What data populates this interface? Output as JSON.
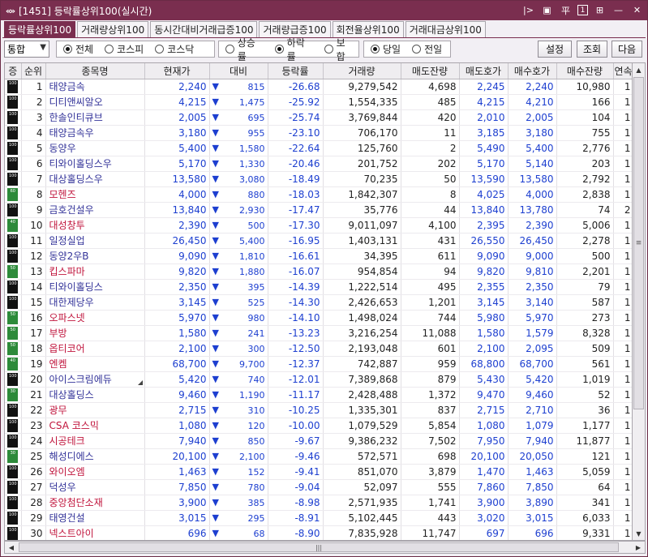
{
  "window": {
    "title": "[1451] 등락률상위100(실시간)",
    "logo": "«»"
  },
  "title_controls": [
    "|>",
    "▣",
    "平",
    "1",
    "⊞",
    "—",
    "✕"
  ],
  "tabs": [
    "등락률상위100",
    "거래량상위100",
    "동시간대비거래급증100",
    "거래량급증100",
    "회전율상위100",
    "거래대금상위100"
  ],
  "filters": {
    "market_select": "통합",
    "market_group": [
      "전체",
      "코스피",
      "코스닥"
    ],
    "market_selected": "전체",
    "trend_group": [
      "상승률",
      "하락률",
      "보합"
    ],
    "trend_selected": "하락률",
    "day_group": [
      "당일",
      "전일"
    ],
    "day_selected": "당일"
  },
  "buttons": {
    "settings": "설정",
    "query": "조회",
    "next": "다음"
  },
  "columns": [
    "증",
    "순위",
    "종목명",
    "현재가",
    "대비",
    "등락률",
    "거래량",
    "매도잔량",
    "매도호가",
    "매수호가",
    "매수잔량",
    "연속"
  ],
  "rows": [
    {
      "badge": "100",
      "rank": "1",
      "name": "태양금속",
      "price": "2,240",
      "diff": "815",
      "rate": "-26.68",
      "volume": "9,279,542",
      "ask_qty": "4,698",
      "ask": "2,245",
      "bid": "2,240",
      "bid_qty": "10,980",
      "cont": "1"
    },
    {
      "badge": "100",
      "rank": "2",
      "name": "디티앤씨알오",
      "price": "4,215",
      "diff": "1,475",
      "rate": "-25.92",
      "volume": "1,554,335",
      "ask_qty": "485",
      "ask": "4,215",
      "bid": "4,210",
      "bid_qty": "166",
      "cont": "1"
    },
    {
      "badge": "100",
      "rank": "3",
      "name": "한솔인티큐브",
      "price": "2,005",
      "diff": "695",
      "rate": "-25.74",
      "volume": "3,769,844",
      "ask_qty": "420",
      "ask": "2,010",
      "bid": "2,005",
      "bid_qty": "104",
      "cont": "1"
    },
    {
      "badge": "100",
      "rank": "4",
      "name": "태양금속우",
      "price": "3,180",
      "diff": "955",
      "rate": "-23.10",
      "volume": "706,170",
      "ask_qty": "11",
      "ask": "3,185",
      "bid": "3,180",
      "bid_qty": "755",
      "cont": "1"
    },
    {
      "badge": "100",
      "rank": "5",
      "name": "동양우",
      "price": "5,400",
      "diff": "1,580",
      "rate": "-22.64",
      "volume": "125,760",
      "ask_qty": "2",
      "ask": "5,490",
      "bid": "5,400",
      "bid_qty": "2,776",
      "cont": "1"
    },
    {
      "badge": "100",
      "rank": "6",
      "name": "티와이홀딩스우",
      "price": "5,170",
      "diff": "1,330",
      "rate": "-20.46",
      "volume": "201,752",
      "ask_qty": "202",
      "ask": "5,170",
      "bid": "5,140",
      "bid_qty": "203",
      "cont": "1"
    },
    {
      "badge": "100",
      "rank": "7",
      "name": "대상홀딩스우",
      "price": "13,580",
      "diff": "3,080",
      "rate": "-18.49",
      "volume": "70,235",
      "ask_qty": "50",
      "ask": "13,590",
      "bid": "13,580",
      "bid_qty": "2,792",
      "cont": "1"
    },
    {
      "badge": "60",
      "rank": "8",
      "name": "모헨즈",
      "price": "4,000",
      "diff": "880",
      "rate": "-18.03",
      "volume": "1,842,307",
      "ask_qty": "8",
      "ask": "4,025",
      "bid": "4,000",
      "bid_qty": "2,838",
      "cont": "1",
      "hl": true
    },
    {
      "badge": "100",
      "rank": "9",
      "name": "금호건설우",
      "price": "13,840",
      "diff": "2,930",
      "rate": "-17.47",
      "volume": "35,776",
      "ask_qty": "44",
      "ask": "13,840",
      "bid": "13,780",
      "bid_qty": "74",
      "cont": "2"
    },
    {
      "badge": "40",
      "rank": "10",
      "name": "대성창투",
      "price": "2,390",
      "diff": "500",
      "rate": "-17.30",
      "volume": "9,011,097",
      "ask_qty": "4,100",
      "ask": "2,395",
      "bid": "2,390",
      "bid_qty": "5,006",
      "cont": "1",
      "hl": true
    },
    {
      "badge": "100",
      "rank": "11",
      "name": "일정실업",
      "price": "26,450",
      "diff": "5,400",
      "rate": "-16.95",
      "volume": "1,403,131",
      "ask_qty": "431",
      "ask": "26,550",
      "bid": "26,450",
      "bid_qty": "2,278",
      "cont": "1"
    },
    {
      "badge": "100",
      "rank": "12",
      "name": "동양2우B",
      "price": "9,090",
      "diff": "1,810",
      "rate": "-16.61",
      "volume": "34,395",
      "ask_qty": "611",
      "ask": "9,090",
      "bid": "9,000",
      "bid_qty": "500",
      "cont": "1"
    },
    {
      "badge": "50",
      "rank": "13",
      "name": "킵스파마",
      "price": "9,820",
      "diff": "1,880",
      "rate": "-16.07",
      "volume": "954,854",
      "ask_qty": "94",
      "ask": "9,820",
      "bid": "9,810",
      "bid_qty": "2,201",
      "cont": "1",
      "hl": true
    },
    {
      "badge": "100",
      "rank": "14",
      "name": "티와이홀딩스",
      "price": "2,350",
      "diff": "395",
      "rate": "-14.39",
      "volume": "1,222,514",
      "ask_qty": "495",
      "ask": "2,355",
      "bid": "2,350",
      "bid_qty": "79",
      "cont": "1"
    },
    {
      "badge": "100",
      "rank": "15",
      "name": "대한제당우",
      "price": "3,145",
      "diff": "525",
      "rate": "-14.30",
      "volume": "2,426,653",
      "ask_qty": "1,201",
      "ask": "3,145",
      "bid": "3,140",
      "bid_qty": "587",
      "cont": "1"
    },
    {
      "badge": "50",
      "rank": "16",
      "name": "오파스넷",
      "price": "5,970",
      "diff": "980",
      "rate": "-14.10",
      "volume": "1,498,024",
      "ask_qty": "744",
      "ask": "5,980",
      "bid": "5,970",
      "bid_qty": "273",
      "cont": "1",
      "hl": true
    },
    {
      "badge": "50",
      "rank": "17",
      "name": "부방",
      "price": "1,580",
      "diff": "241",
      "rate": "-13.23",
      "volume": "3,216,254",
      "ask_qty": "11,088",
      "ask": "1,580",
      "bid": "1,579",
      "bid_qty": "8,328",
      "cont": "1",
      "hl": true
    },
    {
      "badge": "50",
      "rank": "18",
      "name": "옵티코어",
      "price": "2,100",
      "diff": "300",
      "rate": "-12.50",
      "volume": "2,193,048",
      "ask_qty": "601",
      "ask": "2,100",
      "bid": "2,095",
      "bid_qty": "509",
      "cont": "1",
      "hl": true
    },
    {
      "badge": "40",
      "rank": "19",
      "name": "엔켐",
      "price": "68,700",
      "diff": "9,700",
      "rate": "-12.37",
      "volume": "742,887",
      "ask_qty": "959",
      "ask": "68,800",
      "bid": "68,700",
      "bid_qty": "561",
      "cont": "1",
      "hl": true
    },
    {
      "badge": "100",
      "rank": "20",
      "name": "아이스크림에듀",
      "price": "5,420",
      "diff": "740",
      "rate": "-12.01",
      "volume": "7,389,868",
      "ask_qty": "879",
      "ask": "5,430",
      "bid": "5,420",
      "bid_qty": "1,019",
      "cont": "1",
      "flag": true
    },
    {
      "badge": "30",
      "rank": "21",
      "name": "대상홀딩스",
      "price": "9,460",
      "diff": "1,190",
      "rate": "-11.17",
      "volume": "2,428,488",
      "ask_qty": "1,372",
      "ask": "9,470",
      "bid": "9,460",
      "bid_qty": "52",
      "cont": "1"
    },
    {
      "badge": "100",
      "rank": "22",
      "name": "광무",
      "price": "2,715",
      "diff": "310",
      "rate": "-10.25",
      "volume": "1,335,301",
      "ask_qty": "837",
      "ask": "2,715",
      "bid": "2,710",
      "bid_qty": "36",
      "cont": "1",
      "hl": true
    },
    {
      "badge": "100",
      "rank": "23",
      "name": "CSA 코스믹",
      "price": "1,080",
      "diff": "120",
      "rate": "-10.00",
      "volume": "1,079,529",
      "ask_qty": "5,854",
      "ask": "1,080",
      "bid": "1,079",
      "bid_qty": "1,177",
      "cont": "1",
      "hl": true
    },
    {
      "badge": "100",
      "rank": "24",
      "name": "시공테크",
      "price": "7,940",
      "diff": "850",
      "rate": "-9.67",
      "volume": "9,386,232",
      "ask_qty": "7,502",
      "ask": "7,950",
      "bid": "7,940",
      "bid_qty": "11,877",
      "cont": "1",
      "hl": true
    },
    {
      "badge": "30",
      "rank": "25",
      "name": "해성디에스",
      "price": "20,100",
      "diff": "2,100",
      "rate": "-9.46",
      "volume": "572,571",
      "ask_qty": "698",
      "ask": "20,100",
      "bid": "20,050",
      "bid_qty": "121",
      "cont": "1"
    },
    {
      "badge": "100",
      "rank": "26",
      "name": "와이오엠",
      "price": "1,463",
      "diff": "152",
      "rate": "-9.41",
      "volume": "851,070",
      "ask_qty": "3,879",
      "ask": "1,470",
      "bid": "1,463",
      "bid_qty": "5,059",
      "cont": "1",
      "hl": true
    },
    {
      "badge": "100",
      "rank": "27",
      "name": "덕성우",
      "price": "7,850",
      "diff": "780",
      "rate": "-9.04",
      "volume": "52,097",
      "ask_qty": "555",
      "ask": "7,860",
      "bid": "7,850",
      "bid_qty": "64",
      "cont": "1"
    },
    {
      "badge": "100",
      "rank": "28",
      "name": "중앙첨단소재",
      "price": "3,900",
      "diff": "385",
      "rate": "-8.98",
      "volume": "2,571,935",
      "ask_qty": "1,741",
      "ask": "3,900",
      "bid": "3,890",
      "bid_qty": "341",
      "cont": "1",
      "hl": true
    },
    {
      "badge": "100",
      "rank": "29",
      "name": "태영건설",
      "price": "3,015",
      "diff": "295",
      "rate": "-8.91",
      "volume": "5,102,445",
      "ask_qty": "443",
      "ask": "3,020",
      "bid": "3,015",
      "bid_qty": "6,033",
      "cont": "1"
    },
    {
      "badge": "100",
      "rank": "30",
      "name": "넥스트아이",
      "price": "696",
      "diff": "68",
      "rate": "-8.90",
      "volume": "7,835,928",
      "ask_qty": "11,747",
      "ask": "697",
      "bid": "696",
      "bid_qty": "9,331",
      "cont": "1",
      "hl": true
    }
  ],
  "colors": {
    "accent": "#7a2e4f",
    "down": "#1d3fd0",
    "name": "#333399",
    "name_warn": "#c0143c"
  }
}
